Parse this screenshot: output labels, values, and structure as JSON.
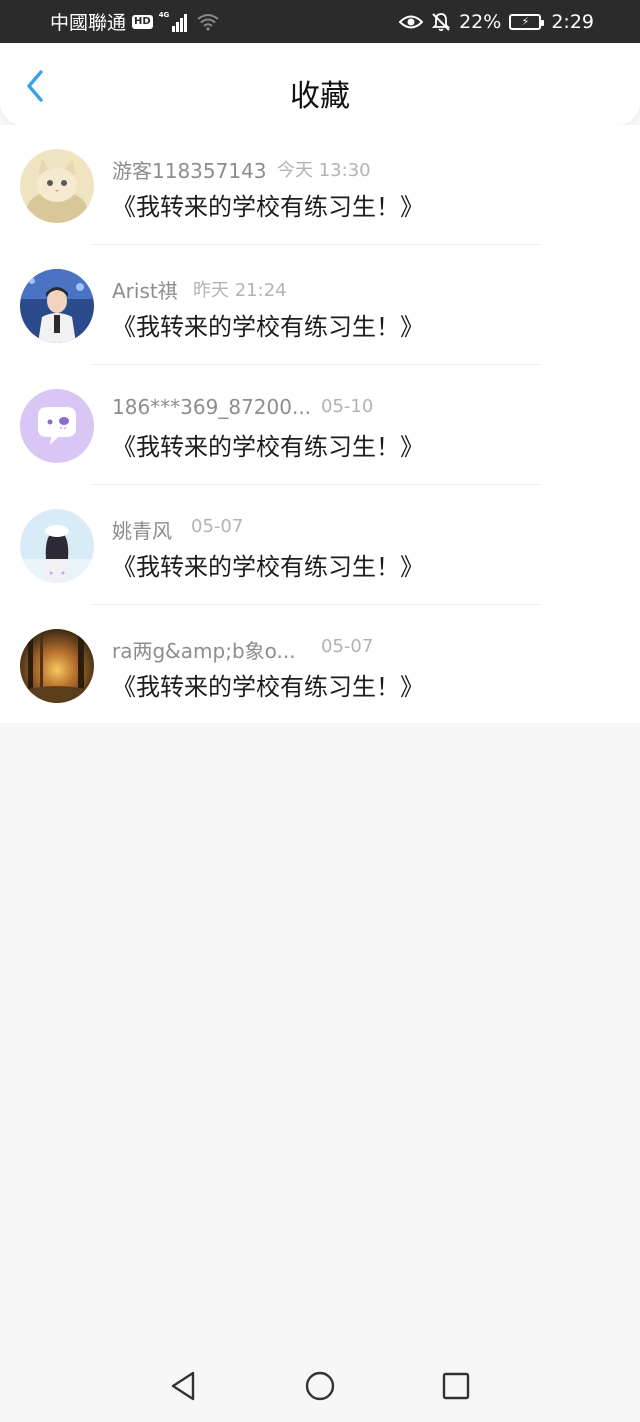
{
  "status_bar": {
    "carrier": "中國聯通",
    "hd_badge": "HD",
    "network": "4G",
    "battery_percent": "22%",
    "time": "2:29"
  },
  "header": {
    "title": "收藏",
    "back_icon": "chevron-left-icon",
    "accent_color": "#3ba0e6"
  },
  "favorites": [
    {
      "user": "游客118357143",
      "time": "今天 13:30",
      "title": "《我转来的学校有练习生！》",
      "avatar_icon": "cat-avatar"
    },
    {
      "user": "Arist祺",
      "time": "昨天 21:24",
      "title": "《我转来的学校有练习生！》",
      "avatar_icon": "boy-photo-avatar"
    },
    {
      "user": "186***369_87200...",
      "time": "05-10",
      "title": "《我转来的学校有练习生！》",
      "avatar_icon": "chat-bubble-avatar"
    },
    {
      "user": "姚青风",
      "time": "05-07",
      "title": "《我转来的学校有练习生！》",
      "avatar_icon": "girl-illustration-avatar"
    },
    {
      "user": "ra两g&amp;b象o...",
      "time": "05-07",
      "title": "《我转来的学校有练习生！》",
      "avatar_icon": "forest-sunset-avatar"
    }
  ],
  "nav_bar": {
    "back": "triangle-back-icon",
    "home": "circle-home-icon",
    "recents": "square-recents-icon"
  }
}
